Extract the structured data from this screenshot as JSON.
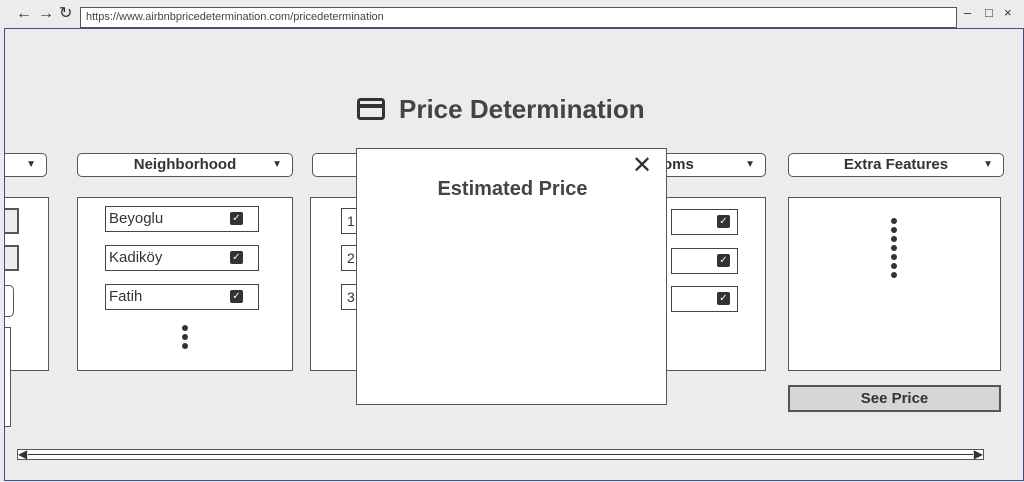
{
  "browser": {
    "url": "https://www.airbnbpricedetermination.com/pricedetermination",
    "back_icon": "←",
    "forward_icon": "→",
    "reload_icon": "↻",
    "minimize": "–",
    "maximize": "□",
    "close": "×"
  },
  "page": {
    "title": "Price Determination",
    "title_icon": "credit-card-icon"
  },
  "filters": {
    "neighborhood_label": "Neighborhood",
    "bedrooms_label_visible": "oms",
    "extra_features_label": "Extra Features",
    "dropdown_arrow": "▼"
  },
  "neighborhood_items": [
    {
      "label": "Beyoglu",
      "checked": true
    },
    {
      "label": "Kadiköy",
      "checked": true
    },
    {
      "label": "Fatih",
      "checked": true
    }
  ],
  "third_panel_items": [
    "1",
    "2",
    "3"
  ],
  "checkmark": "✓",
  "see_price_label": "See Price",
  "modal": {
    "title": "Estimated Price",
    "close": "✕"
  },
  "scrollbar": {
    "left_arrow": "◀",
    "right_arrow": "▶"
  }
}
